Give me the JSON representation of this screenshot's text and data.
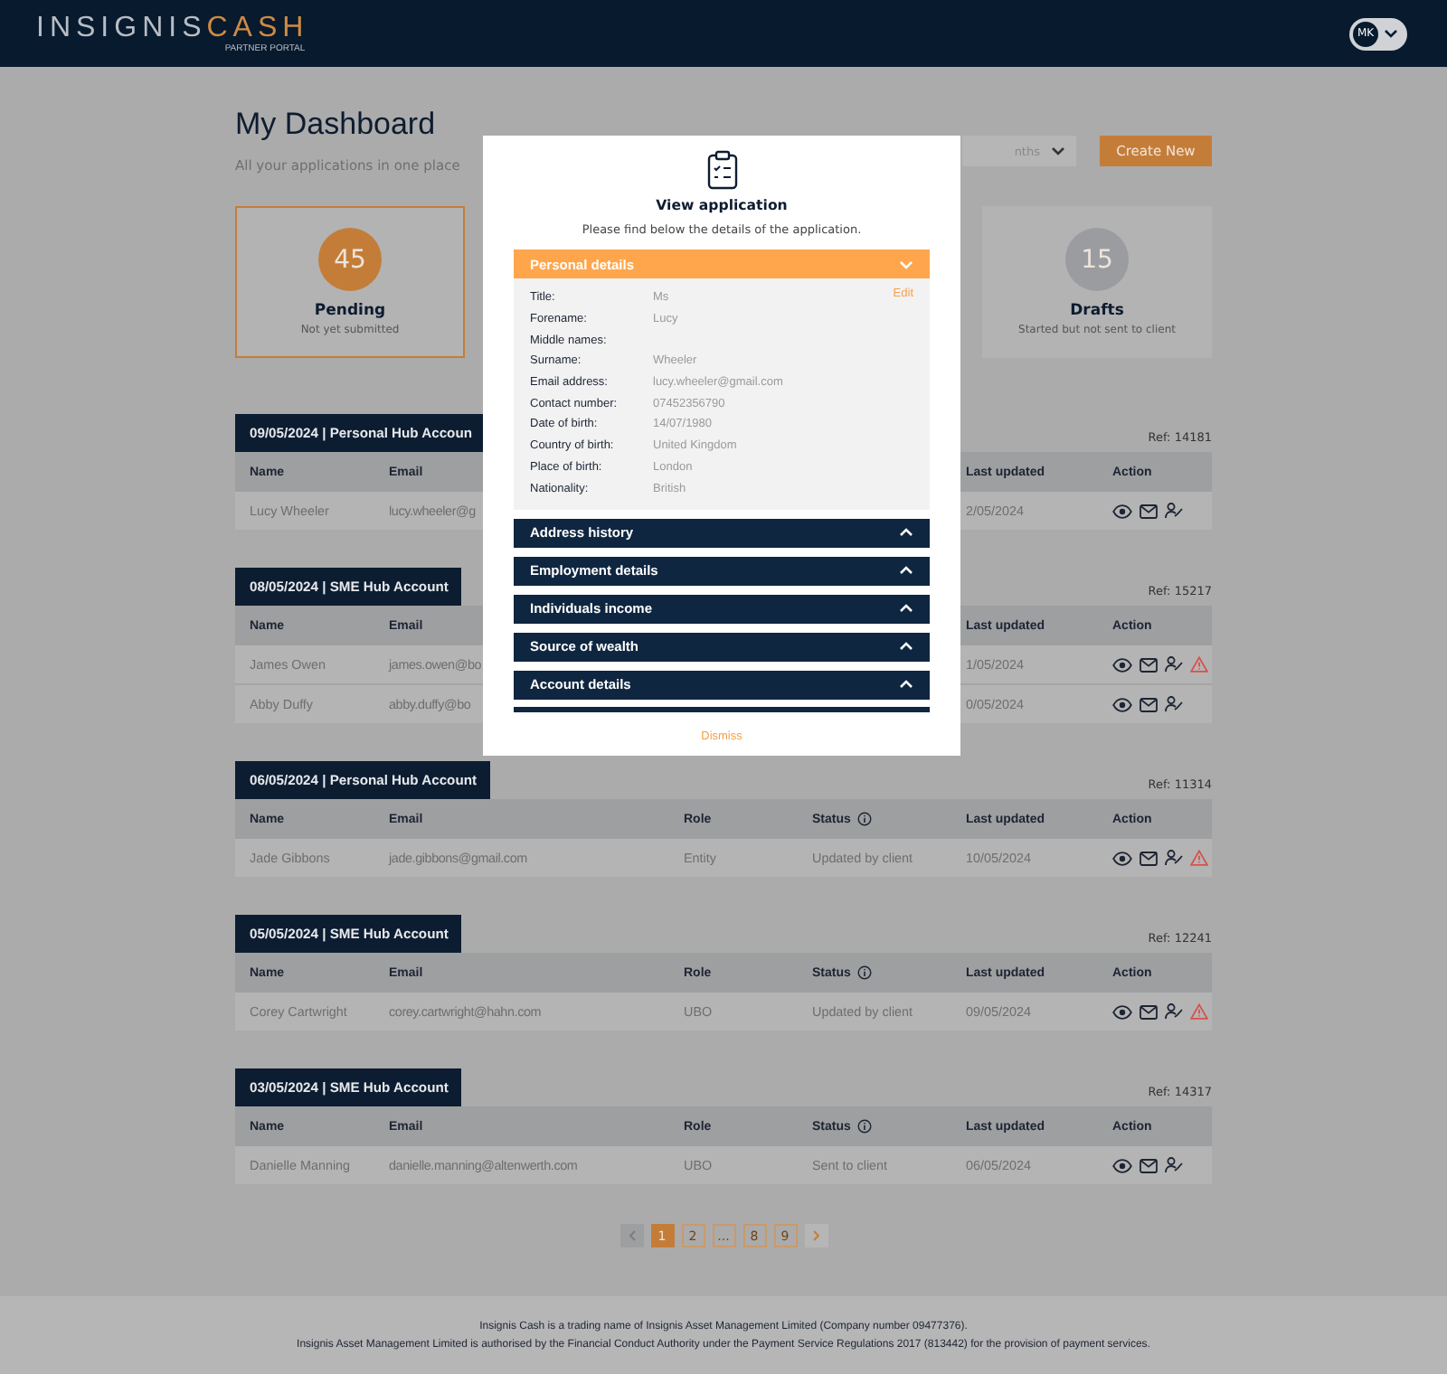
{
  "header": {
    "logo_primary": "INSIGNIS",
    "logo_accent": "CASH",
    "logo_sub": "PARTNER PORTAL",
    "avatar": "MK"
  },
  "dashboard": {
    "title": "My Dashboard",
    "subtitle": "All your applications in one place",
    "period_select": "nths",
    "create_button": "Create New"
  },
  "cards": [
    {
      "count": "45",
      "label": "Pending",
      "sublabel": "Not yet submitted",
      "selected": true,
      "color": "#c47d39"
    },
    {
      "count": "15",
      "label": "Drafts",
      "sublabel": "Started but not sent to client",
      "selected": false,
      "color": "#9a9ca0"
    }
  ],
  "groups": [
    {
      "heading": "09/05/2024 | Personal Hub Accoun",
      "ref": "Ref: 14181",
      "columns": {
        "name": "Name",
        "email": "Email",
        "last_updated": "Last updated",
        "action": "Action"
      },
      "rows": [
        {
          "name": "Lucy Wheeler",
          "email": "lucy.wheeler@g",
          "last_updated": "2/05/2024",
          "warning": false
        }
      ]
    },
    {
      "heading": "08/05/2024 | SME Hub Account",
      "ref": "Ref: 15217",
      "columns": {
        "name": "Name",
        "email": "Email",
        "last_updated": "Last updated",
        "action": "Action"
      },
      "rows": [
        {
          "name": "James Owen",
          "email": "james.owen@bo",
          "last_updated": "1/05/2024",
          "warning": true
        },
        {
          "name": "Abby Duffy",
          "email": "abby.duffy@bo",
          "last_updated": "0/05/2024",
          "warning": false
        }
      ]
    },
    {
      "heading": "06/05/2024 | Personal Hub Account",
      "ref": "Ref: 11314",
      "columns": {
        "name": "Name",
        "email": "Email",
        "role": "Role",
        "status": "Status",
        "last_updated": "Last updated",
        "action": "Action"
      },
      "rows": [
        {
          "name": "Jade Gibbons",
          "email": "jade.gibbons@gmail.com",
          "role": "Entity",
          "status": "Updated by client",
          "last_updated": "10/05/2024",
          "warning": true
        }
      ]
    },
    {
      "heading": "05/05/2024 | SME Hub Account",
      "ref": "Ref: 12241",
      "columns": {
        "name": "Name",
        "email": "Email",
        "role": "Role",
        "status": "Status",
        "last_updated": "Last updated",
        "action": "Action"
      },
      "rows": [
        {
          "name": "Corey Cartwright",
          "email": "corey.cartwright@hahn.com",
          "role": "UBO",
          "status": "Updated by client",
          "last_updated": "09/05/2024",
          "warning": true
        }
      ]
    },
    {
      "heading": "03/05/2024 | SME Hub Account",
      "ref": "Ref: 14317",
      "columns": {
        "name": "Name",
        "email": "Email",
        "role": "Role",
        "status": "Status",
        "last_updated": "Last updated",
        "action": "Action"
      },
      "rows": [
        {
          "name": "Danielle Manning",
          "email": "danielle.manning@altenwerth.com",
          "role": "UBO",
          "status": "Sent to client",
          "last_updated": "06/05/2024",
          "warning": false
        }
      ]
    }
  ],
  "pagination": {
    "previous": {
      "disabled": true
    },
    "pages": [
      {
        "label": "1",
        "selected": true
      },
      {
        "label": "2",
        "selected": false
      },
      {
        "label": "...",
        "selected": false
      },
      {
        "label": "8",
        "selected": false
      },
      {
        "label": "9",
        "selected": false
      }
    ],
    "next": {
      "disabled": false
    }
  },
  "footer": [
    "Insignis Cash is a trading name of Insignis Asset Management Limited (Company number 09477376).",
    "Insignis Asset Management Limited is authorised by the Financial Conduct Authority under the Payment Service Regulations 2017 (813442) for the provision of payment services."
  ],
  "modal": {
    "title": "View application",
    "subtitle": "Please find below the details of the application.",
    "sections": [
      {
        "title": "Personal details",
        "expanded": true,
        "edit": "Edit",
        "fields": [
          {
            "label": "Title:",
            "value": "Ms"
          },
          {
            "label": "Forename:",
            "value": "Lucy"
          },
          {
            "label": "Middle names:"
          },
          {
            "label": "Surname:",
            "value": "Wheeler"
          },
          {
            "label": "Email address:",
            "value": "lucy.wheeler@gmail.com"
          },
          {
            "label": "Contact number:",
            "value": "07452356790"
          },
          {
            "label": "Date of birth:",
            "value": "14/07/1980"
          },
          {
            "label": "Country of birth:",
            "value": "United Kingdom"
          },
          {
            "label": "Place of birth:",
            "value": "London"
          },
          {
            "label": "Nationality:",
            "value": "British"
          }
        ]
      },
      {
        "title": "Address history",
        "expanded": false
      },
      {
        "title": "Employment details",
        "expanded": false
      },
      {
        "title": "Individuals income",
        "expanded": false
      },
      {
        "title": "Source of wealth",
        "expanded": false
      },
      {
        "title": "Account details",
        "expanded": false
      }
    ],
    "dismiss": "Dismiss"
  }
}
